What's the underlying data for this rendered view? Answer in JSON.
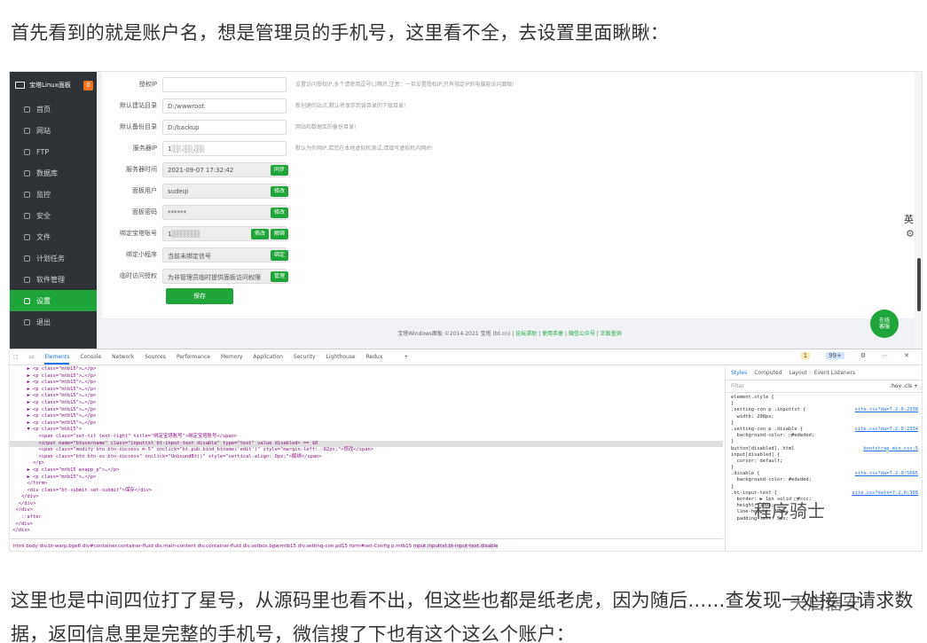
{
  "article": {
    "para_top": "首先看到的就是账户名，想是管理员的手机号，这里看不全，去设置里面瞅瞅：",
    "para_bottom": "这里也是中间四位打了星号，从源码里也看不出，但这些也都是纸老虎，因为随后……查发现一处接口请求数据，返回信息里是完整的手机号，微信搜了下也有这个这么个账户："
  },
  "watermarks": [
    "程序骑士",
    "天启信安"
  ],
  "sidebar": {
    "logo_text": "宝塔Linux面板",
    "badge": "0",
    "items": [
      {
        "label": "首页"
      },
      {
        "label": "网站"
      },
      {
        "label": "FTP"
      },
      {
        "label": "数据库"
      },
      {
        "label": "监控"
      },
      {
        "label": "安全"
      },
      {
        "label": "文件"
      },
      {
        "label": "计划任务"
      },
      {
        "label": "软件管理"
      },
      {
        "label": "设置"
      },
      {
        "label": "退出"
      }
    ],
    "active_index": 9
  },
  "settings": {
    "rows": [
      {
        "label": "授权IP",
        "value": "",
        "hint": "设置访问授权IP,多个请使用逗号(,)隔开,注意：一旦设置授权IP,只有指定IP的电脑能访问面板!"
      },
      {
        "label": "默认建站目录",
        "value": "D:/wwwroot",
        "hint": "新创建的站点,默认将保存到该目录的下级目录!"
      },
      {
        "label": "默认备份目录",
        "value": "D:/backup",
        "hint": "网站和数据库的备份目录!"
      },
      {
        "label": "服务器IP",
        "value": "1░░.░░.░░",
        "hint": "默认为外网IP,若您在本地虚拟机测试,请填写虚拟机内网IP!"
      },
      {
        "label": "服务器时间",
        "value": "2021-09-07 17:32:42",
        "button": "同步"
      },
      {
        "label": "面板用户",
        "value": "sudeqi",
        "button": "修改"
      },
      {
        "label": "面板密码",
        "value": "******",
        "button": "修改"
      },
      {
        "label": "绑定宝塔账号",
        "value": "1░░░░░░",
        "buttons": [
          "修改",
          "解绑"
        ]
      },
      {
        "label": "绑定小程序",
        "value": "当前未绑定信号",
        "button": "绑定"
      },
      {
        "label": "临时访问授权",
        "value": "为非管理员临时提供面板访问权限",
        "button": "管理"
      }
    ],
    "save_label": "保存"
  },
  "floating": {
    "lang": "英",
    "online_l1": "在线",
    "online_l2": "客服"
  },
  "footer": {
    "text": "宝塔Windows面板 ©2014-2021 宝塔 (bt.cn)",
    "links": [
      "论坛求助",
      "使用手册",
      "微信公众号",
      "正版查询"
    ]
  },
  "devtools": {
    "tabs": [
      "Elements",
      "Console",
      "Network",
      "Sources",
      "Performance",
      "Memory",
      "Application",
      "Security",
      "Lighthouse",
      "Redux"
    ],
    "active_tab": "Elements",
    "warn_count": "1",
    "info_count": "99+",
    "dom_lines": [
      "      ▶ <p class=\"mtb15\">…</p>",
      "      ▶ <p class=\"mtb15\">…</p>",
      "      ▶ <p class=\"mtb15\">…</p>",
      "      ▶ <p class=\"mtb15\">…</p>",
      "      ▶ <p class=\"mtb15\">…</p>",
      "      ▶ <p class=\"mtb15\">…</p>",
      "      ▶ <p class=\"mtb15\">…</p>",
      "      ▶ <p class=\"mtb15\">…</p>",
      "      ▶ <p class=\"mtb15\">…</p>",
      "      ▼ <p class=\"mtb15\">",
      "          <span class=\"set-tit text-right\" title=\"绑定宝塔账号\">绑定宝塔账号</span>",
      "          <input name=\"btusername\" class=\"inputtxt bt-input-text disable\" type=\"text\" value disabled> == $0",
      "          <span class=\"modify btn btn-success m-5\" onclick=\"bt.pub.bind_btname('edit')\" style=\"margin-left: -82px;\">修改</span>",
      "          <span class=\"btn btn-xs btn-success\" onclick=\"UnboundBt()\" style=\"vertical-align: 0px;\">解绑</span>",
      "        </p>",
      "      ▶ <p class=\"mtb15 wxapp_p\">…</p>",
      "      ▶ <p class=\"mtb15\">…</p>",
      "      </form>",
      "      <div class=\"bt-submit set-submit\">保存</div>",
      "    </div>",
      "   </div>",
      "  </div>",
      "    ::after",
      "  </div>",
      " </div>"
    ],
    "selected_line": 11,
    "breadcrumbs": [
      "html",
      "body",
      "div.bt-warp.bge6",
      "div#container.container-fluid",
      "div.main-content",
      "div.container-fluid",
      "div.setbox.bgw.mtb15",
      "div.setting-con.pd15",
      "form#set-Config",
      "p.mtb15",
      "input.inputtxt.bt-input-text.disable"
    ],
    "styles_tabs": [
      "Styles",
      "Computed",
      "Layout",
      "Event Listeners"
    ],
    "styles_filter": "Filter",
    "styles_filter_right": ":hov .cls +",
    "style_lines": [
      "element.style {",
      "}",
      ".setting-con p .inputtxt {",
      "  width: 208px;",
      "}",
      ".setting-con p .disable {",
      "  background-color: □#ededed;",
      "}",
      "button[disabled], html",
      "input[disabled] {",
      "  cursor: default;",
      "}",
      ".disable {",
      "  background-color: #ededed;",
      "}",
      ".bt-input-text {",
      "  border: ▶ 1px solid □#ccc;",
      "  height: 30px;",
      "  line-height: 30px;",
      "  padding-left: 5px;"
    ],
    "style_sources": [
      "",
      "",
      "site.css?da=7.2.0:2338",
      "",
      "",
      "site.css?da=7.2.0:2334",
      "",
      "",
      "bootstrap.min.css:5",
      "",
      "",
      "",
      "site.css?da=7.2.0:5665",
      "",
      "",
      "site.css?date=7.2.0:308",
      "",
      "",
      "",
      ""
    ]
  }
}
